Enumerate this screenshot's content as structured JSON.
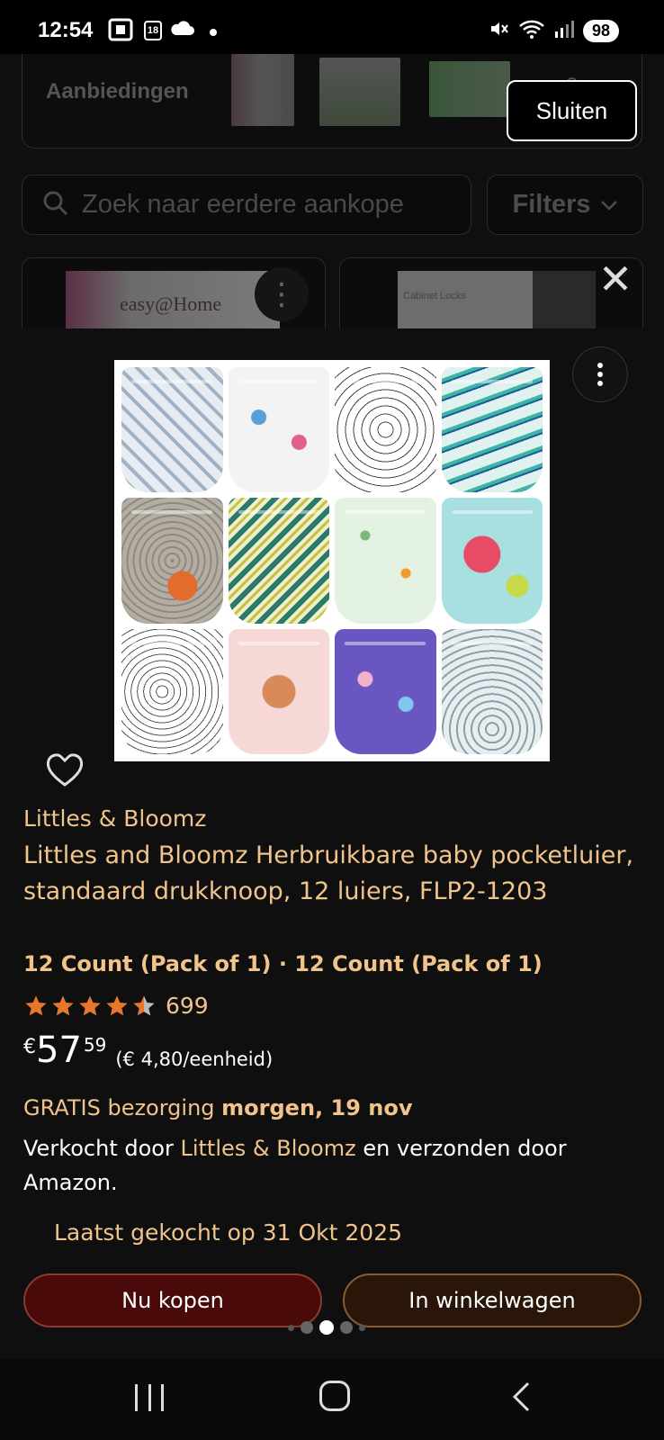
{
  "status_bar": {
    "time": "12:54",
    "calendar_day": "18",
    "battery": "98",
    "icons": [
      "screenshot-icon",
      "calendar-icon",
      "cloud-icon",
      "dot-icon",
      "mute-icon",
      "wifi-icon",
      "signal-icon",
      "battery-icon"
    ]
  },
  "background": {
    "deals_label": "Aanbiedingen",
    "deals_more": "+3",
    "close_label": "Sluiten",
    "search_placeholder": "Zoek naar eerdere aankope",
    "filters_label": "Filters",
    "card_left_brand": "easy@Home",
    "card_right_brand": "Cabinet Locks"
  },
  "product": {
    "brand": "Littles & Bloomz",
    "title": "Littles and Bloomz Herbruikbare baby pocketluier, standaard drukknoop, 12 luiers, FLP2-1203",
    "variant": "12 Count (Pack of 1) · 12 Count (Pack of 1)",
    "rating": 4.5,
    "rating_count": "699",
    "price_currency": "€",
    "price_whole": "57",
    "price_fraction": "59",
    "unit_price": "(€ 4,80/eenheid)",
    "delivery_prefix": "GRATIS bezorging",
    "delivery_date": "morgen, 19 nov",
    "seller_prefix": "Verkocht door",
    "seller_name": "Littles & Bloomz",
    "seller_suffix": "en verzonden door Amazon.",
    "last_bought": "Laatst gekocht op 31 Okt 2025",
    "buy_now_label": "Nu kopen",
    "add_to_cart_label": "In winkelwagen",
    "carousel_index": 2,
    "carousel_count": 5
  },
  "colors": {
    "accent_text": "#f0c48a",
    "star": "#e8772e",
    "buy_bg": "#4a0a0a",
    "cart_bg": "#2a1608"
  }
}
